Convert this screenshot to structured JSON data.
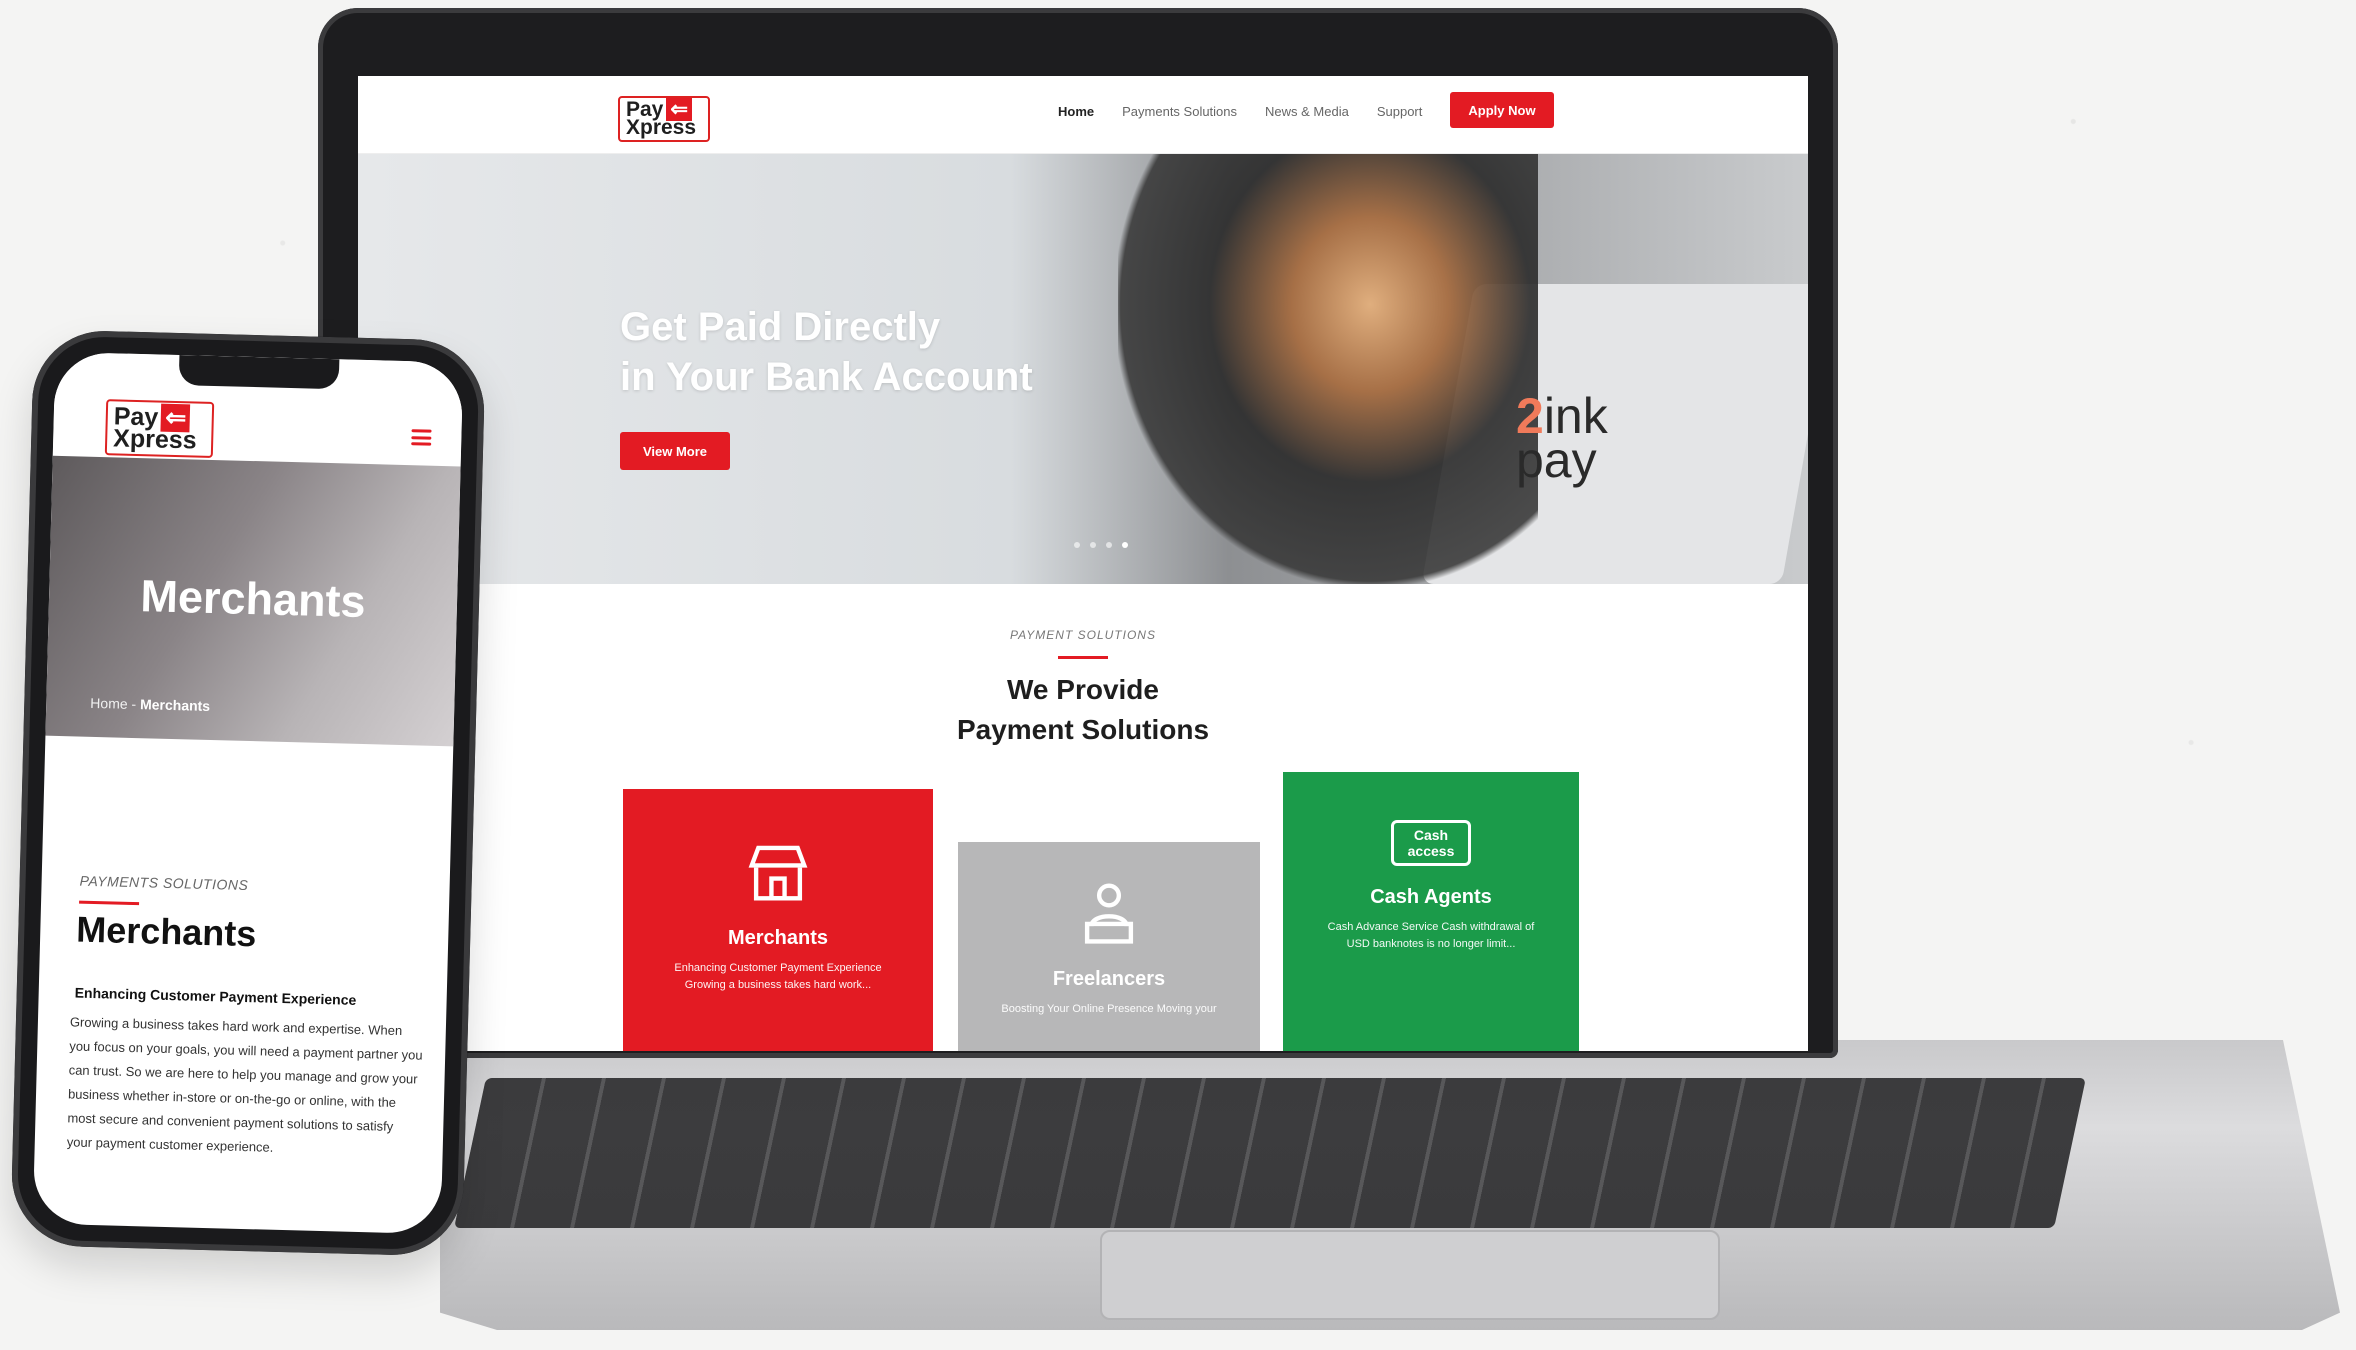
{
  "laptop_site": {
    "logo": {
      "word1": "Pay",
      "word2": "Xpress"
    },
    "nav": [
      "Home",
      "Payments Solutions",
      "News & Media",
      "Support"
    ],
    "apply_label": "Apply Now",
    "hero": {
      "title_line1": "Get Paid Directly",
      "title_line2": "in Your Bank Account",
      "cta": "View More",
      "brand_text": "ink pay"
    },
    "section": {
      "kicker": "PAYMENT SOLUTIONS",
      "title_line1": "We Provide",
      "title_line2": "Payment Solutions"
    },
    "cards": [
      {
        "title": "Merchants",
        "desc": "Enhancing Customer Payment Experience Growing a business takes hard work...",
        "color": "#e31b23",
        "icon": "storefront-icon"
      },
      {
        "title": "Freelancers",
        "desc": "Boosting Your Online Presence Moving your",
        "color": "#b7b7b8",
        "icon": "person-laptop-icon"
      },
      {
        "title": "Cash Agents",
        "desc": "Cash Advance Service Cash withdrawal of USD banknotes is no longer limit...",
        "color": "#1b9b4a",
        "icon": "cash-access-icon",
        "icon_text": "Cash access"
      }
    ]
  },
  "phone_site": {
    "logo": {
      "word1": "Pay",
      "word2": "Xpress"
    },
    "banner_title": "Merchants",
    "breadcrumb": {
      "home": "Home",
      "sep": "-",
      "current": "Merchants"
    },
    "kicker": "PAYMENTS SOLUTIONS",
    "heading": "Merchants",
    "subheading": "Enhancing Customer Payment Experience",
    "body": "Growing a business takes hard work and expertise. When you focus on your goals, you will need a payment partner you can trust. So we are here to help you manage and grow your business whether in-store or on-the-go or online, with the most secure and convenient payment solutions to satisfy your payment customer experience."
  },
  "colors": {
    "brand_red": "#e31b23",
    "brand_green": "#1b9b4a",
    "card_grey": "#b7b7b8"
  }
}
